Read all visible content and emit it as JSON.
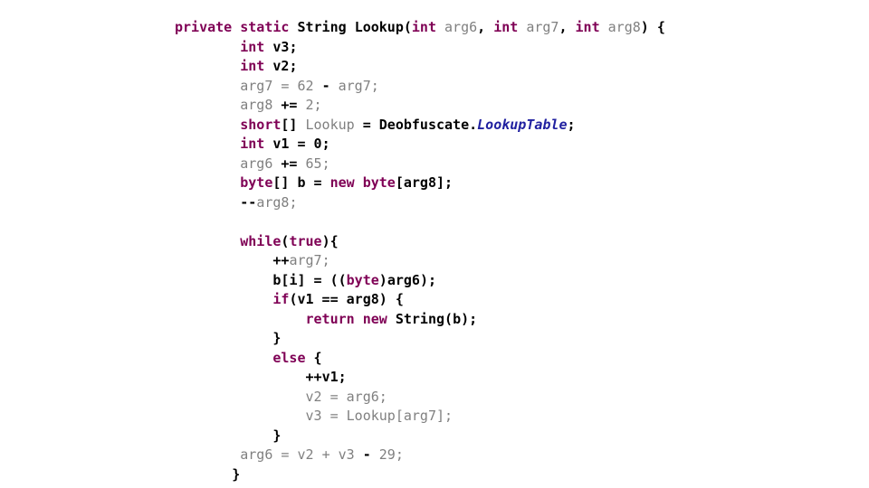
{
  "viewer": {
    "title": "Lookup",
    "language": "Java",
    "background_color": "#ffffff"
  },
  "theme": {
    "keyword_color": "#7f0055",
    "identifier_color": "#808080",
    "local_color": "#000000",
    "field_color": "#2020a0",
    "punctuation_color": "#000000"
  },
  "code": {
    "full_text": "private static String Lookup(int arg6, int arg7, int arg8) {\n    int v3;\n    int v2;\n    arg7 = 62 - arg7;\n    arg8 += 2;\n    short[] Lookup = Deobfuscate.LookupTable;\n    int v1 = 0;\n    arg6 += 65;\n    byte[] b = new byte[arg8];\n    --arg8;\n\n    while(true){\n        ++arg7;\n        b[i] = ((byte)arg6);\n        if(v1 == arg8) {\n            return new String(b);\n        }\n        else {\n            ++v1;\n            v2 = arg6;\n            v3 = Lookup[arg7];\n        }\n        arg6 = v2 + v3 - 29;\n    }",
    "lines": [
      {
        "indent": 0,
        "tokens": [
          {
            "t": "private",
            "c": "kw"
          },
          {
            "t": " ",
            "c": "punc"
          },
          {
            "t": "static",
            "c": "kw"
          },
          {
            "t": " ",
            "c": "punc"
          },
          {
            "t": "String",
            "c": "plain"
          },
          {
            "t": " ",
            "c": "punc"
          },
          {
            "t": "Lookup",
            "c": "plain"
          },
          {
            "t": "(",
            "c": "punc"
          },
          {
            "t": "int",
            "c": "kw"
          },
          {
            "t": " ",
            "c": "punc"
          },
          {
            "t": "arg6",
            "c": "ident"
          },
          {
            "t": ", ",
            "c": "punc"
          },
          {
            "t": "int",
            "c": "kw"
          },
          {
            "t": " ",
            "c": "punc"
          },
          {
            "t": "arg7",
            "c": "ident"
          },
          {
            "t": ", ",
            "c": "punc"
          },
          {
            "t": "int",
            "c": "kw"
          },
          {
            "t": " ",
            "c": "punc"
          },
          {
            "t": "arg8",
            "c": "ident"
          },
          {
            "t": ") {",
            "c": "punc"
          }
        ]
      },
      {
        "indent": 8,
        "tokens": [
          {
            "t": "int",
            "c": "kw"
          },
          {
            "t": " ",
            "c": "punc"
          },
          {
            "t": "v3",
            "c": "plain"
          },
          {
            "t": ";",
            "c": "punc"
          }
        ]
      },
      {
        "indent": 8,
        "tokens": [
          {
            "t": "int",
            "c": "kw"
          },
          {
            "t": " ",
            "c": "punc"
          },
          {
            "t": "v2",
            "c": "plain"
          },
          {
            "t": ";",
            "c": "punc"
          }
        ]
      },
      {
        "indent": 8,
        "tokens": [
          {
            "t": "arg7",
            "c": "ident"
          },
          {
            "t": " = ",
            "c": "ident"
          },
          {
            "t": "62",
            "c": "numg"
          },
          {
            "t": " ",
            "c": "ident"
          },
          {
            "t": "-",
            "c": "punc"
          },
          {
            "t": " ",
            "c": "ident"
          },
          {
            "t": "arg7",
            "c": "ident"
          },
          {
            "t": ";",
            "c": "ident"
          }
        ]
      },
      {
        "indent": 8,
        "tokens": [
          {
            "t": "arg8",
            "c": "ident"
          },
          {
            "t": " ",
            "c": "ident"
          },
          {
            "t": "+=",
            "c": "punc"
          },
          {
            "t": " ",
            "c": "ident"
          },
          {
            "t": "2",
            "c": "numg"
          },
          {
            "t": ";",
            "c": "ident"
          }
        ]
      },
      {
        "indent": 8,
        "tokens": [
          {
            "t": "short",
            "c": "kw"
          },
          {
            "t": "[]",
            "c": "punc"
          },
          {
            "t": " ",
            "c": "punc"
          },
          {
            "t": "Lookup",
            "c": "ident"
          },
          {
            "t": " = ",
            "c": "punc"
          },
          {
            "t": "Deobfuscate",
            "c": "plain"
          },
          {
            "t": ".",
            "c": "punc"
          },
          {
            "t": "LookupTable",
            "c": "field"
          },
          {
            "t": ";",
            "c": "punc"
          }
        ]
      },
      {
        "indent": 8,
        "tokens": [
          {
            "t": "int",
            "c": "kw"
          },
          {
            "t": " ",
            "c": "punc"
          },
          {
            "t": "v1",
            "c": "plain"
          },
          {
            "t": " = ",
            "c": "punc"
          },
          {
            "t": "0",
            "c": "num"
          },
          {
            "t": ";",
            "c": "punc"
          }
        ]
      },
      {
        "indent": 8,
        "tokens": [
          {
            "t": "arg6",
            "c": "ident"
          },
          {
            "t": " ",
            "c": "ident"
          },
          {
            "t": "+=",
            "c": "punc"
          },
          {
            "t": " ",
            "c": "ident"
          },
          {
            "t": "65",
            "c": "numg"
          },
          {
            "t": ";",
            "c": "ident"
          }
        ]
      },
      {
        "indent": 8,
        "tokens": [
          {
            "t": "byte",
            "c": "kw"
          },
          {
            "t": "[]",
            "c": "punc"
          },
          {
            "t": " ",
            "c": "punc"
          },
          {
            "t": "b",
            "c": "plain"
          },
          {
            "t": " = ",
            "c": "punc"
          },
          {
            "t": "new",
            "c": "kw"
          },
          {
            "t": " ",
            "c": "punc"
          },
          {
            "t": "byte",
            "c": "kw"
          },
          {
            "t": "[",
            "c": "punc"
          },
          {
            "t": "arg8",
            "c": "plain"
          },
          {
            "t": "];",
            "c": "punc"
          }
        ]
      },
      {
        "indent": 8,
        "tokens": [
          {
            "t": "--",
            "c": "punc"
          },
          {
            "t": "arg8",
            "c": "ident"
          },
          {
            "t": ";",
            "c": "ident"
          }
        ]
      },
      {
        "indent": 0,
        "tokens": []
      },
      {
        "indent": 8,
        "tokens": [
          {
            "t": "while",
            "c": "kw"
          },
          {
            "t": "(",
            "c": "punc"
          },
          {
            "t": "true",
            "c": "kw"
          },
          {
            "t": "){",
            "c": "punc"
          }
        ]
      },
      {
        "indent": 12,
        "tokens": [
          {
            "t": "++",
            "c": "punc"
          },
          {
            "t": "arg7",
            "c": "ident"
          },
          {
            "t": ";",
            "c": "ident"
          }
        ]
      },
      {
        "indent": 12,
        "tokens": [
          {
            "t": "b",
            "c": "plain"
          },
          {
            "t": "[",
            "c": "punc"
          },
          {
            "t": "i",
            "c": "plain"
          },
          {
            "t": "] = ((",
            "c": "punc"
          },
          {
            "t": "byte",
            "c": "kw"
          },
          {
            "t": ")",
            "c": "punc"
          },
          {
            "t": "arg6",
            "c": "plain"
          },
          {
            "t": ");",
            "c": "punc"
          }
        ]
      },
      {
        "indent": 12,
        "tokens": [
          {
            "t": "if",
            "c": "kw"
          },
          {
            "t": "(",
            "c": "punc"
          },
          {
            "t": "v1",
            "c": "plain"
          },
          {
            "t": " == ",
            "c": "punc"
          },
          {
            "t": "arg8",
            "c": "plain"
          },
          {
            "t": ") {",
            "c": "punc"
          }
        ]
      },
      {
        "indent": 16,
        "tokens": [
          {
            "t": "return",
            "c": "kw"
          },
          {
            "t": " ",
            "c": "punc"
          },
          {
            "t": "new",
            "c": "kw"
          },
          {
            "t": " ",
            "c": "punc"
          },
          {
            "t": "String",
            "c": "plain"
          },
          {
            "t": "(",
            "c": "punc"
          },
          {
            "t": "b",
            "c": "plain"
          },
          {
            "t": ");",
            "c": "punc"
          }
        ]
      },
      {
        "indent": 12,
        "tokens": [
          {
            "t": "}",
            "c": "punc"
          }
        ]
      },
      {
        "indent": 12,
        "tokens": [
          {
            "t": "else",
            "c": "kw"
          },
          {
            "t": " {",
            "c": "punc"
          }
        ]
      },
      {
        "indent": 16,
        "tokens": [
          {
            "t": "++",
            "c": "punc"
          },
          {
            "t": "v1",
            "c": "plain"
          },
          {
            "t": ";",
            "c": "punc"
          }
        ]
      },
      {
        "indent": 16,
        "tokens": [
          {
            "t": "v2",
            "c": "ident"
          },
          {
            "t": " = ",
            "c": "ident"
          },
          {
            "t": "arg6",
            "c": "ident"
          },
          {
            "t": ";",
            "c": "ident"
          }
        ]
      },
      {
        "indent": 16,
        "tokens": [
          {
            "t": "v3",
            "c": "ident"
          },
          {
            "t": " = ",
            "c": "ident"
          },
          {
            "t": "Lookup",
            "c": "ident"
          },
          {
            "t": "[",
            "c": "ident"
          },
          {
            "t": "arg7",
            "c": "ident"
          },
          {
            "t": "];",
            "c": "ident"
          }
        ]
      },
      {
        "indent": 12,
        "tokens": [
          {
            "t": "}",
            "c": "punc"
          }
        ]
      },
      {
        "indent": 8,
        "tokens": [
          {
            "t": "arg6",
            "c": "ident"
          },
          {
            "t": " = ",
            "c": "ident"
          },
          {
            "t": "v2",
            "c": "ident"
          },
          {
            "t": " ",
            "c": "ident"
          },
          {
            "t": "+",
            "c": "ident"
          },
          {
            "t": " ",
            "c": "ident"
          },
          {
            "t": "v3",
            "c": "ident"
          },
          {
            "t": " ",
            "c": "ident"
          },
          {
            "t": "-",
            "c": "punc"
          },
          {
            "t": " ",
            "c": "ident"
          },
          {
            "t": "29",
            "c": "numg"
          },
          {
            "t": ";",
            "c": "ident"
          }
        ]
      },
      {
        "indent": 7,
        "tokens": [
          {
            "t": "}",
            "c": "punc"
          }
        ]
      }
    ]
  }
}
